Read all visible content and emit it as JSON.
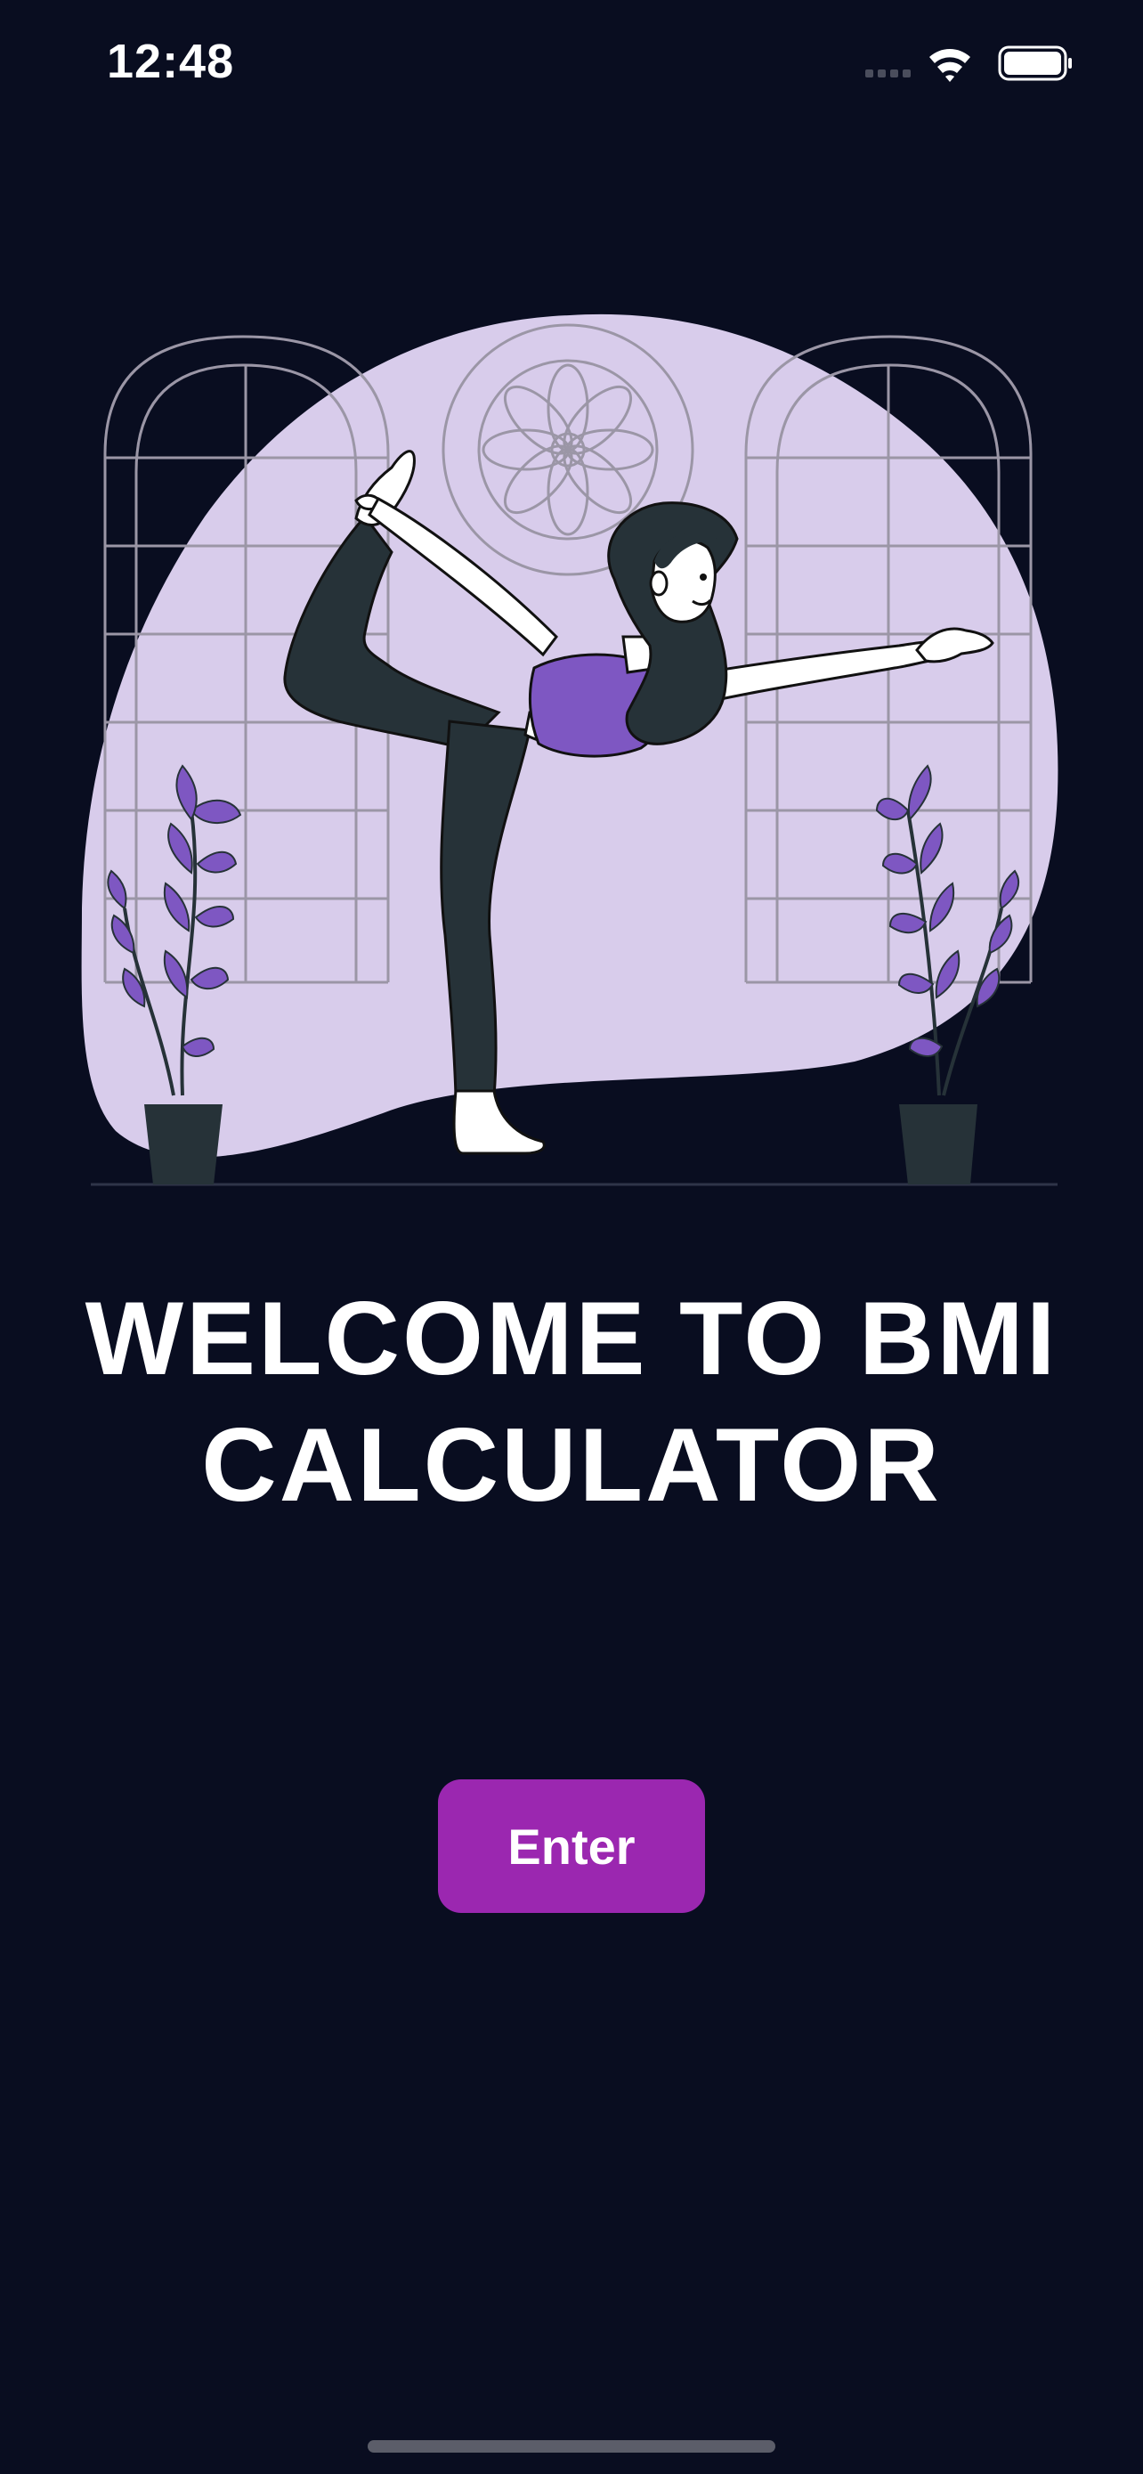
{
  "status_bar": {
    "time": "12:48",
    "icons": [
      "cellular-signal-icon",
      "wifi-icon",
      "battery-icon"
    ]
  },
  "hero": {
    "illustration": "woman-yoga-dancer-pose-illustration",
    "colors": {
      "blob": "#d8cceb",
      "accent": "#7e57c2",
      "figure_dark": "#263238"
    }
  },
  "welcome": {
    "title": "WELCOME TO BMI CALCULATOR"
  },
  "enter_button": {
    "label": "Enter",
    "color": "#9b27b0"
  },
  "theme": {
    "background": "#090d20"
  }
}
